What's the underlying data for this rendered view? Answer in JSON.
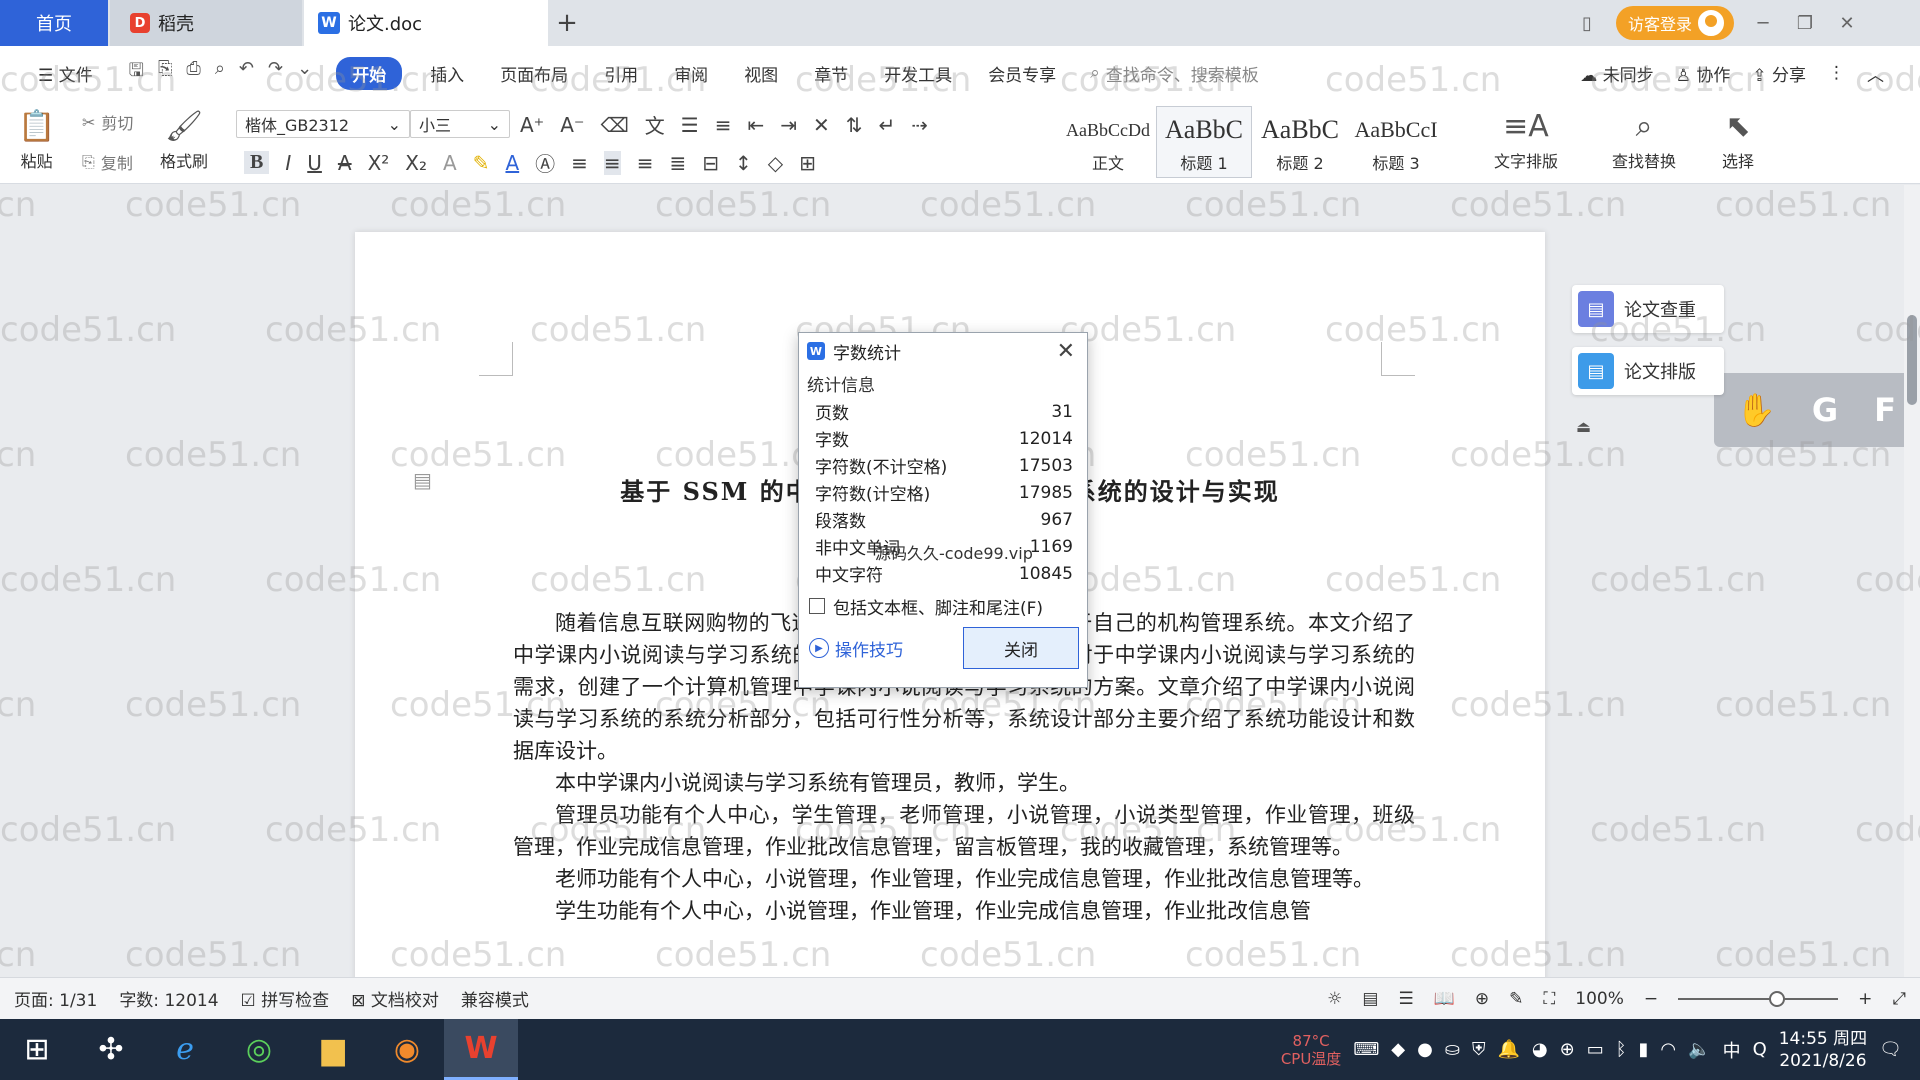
{
  "tabs": {
    "home": "首页",
    "daoke": "稻壳",
    "doc": "论文.doc",
    "add": "+"
  },
  "account": {
    "login": "访客登录"
  },
  "menu": {
    "file": "文件",
    "items": [
      "开始",
      "插入",
      "页面布局",
      "引用",
      "审阅",
      "视图",
      "章节",
      "开发工具",
      "会员专享"
    ],
    "search_placeholder": "查找命令、搜索模板",
    "sync": "未同步",
    "collab": "协作",
    "share": "分享"
  },
  "ribbon": {
    "paste": "粘贴",
    "cut": "剪切",
    "copy": "复制",
    "format_painter": "格式刷",
    "font_name": "楷体_GB2312",
    "font_size": "小三",
    "styles": [
      {
        "preview": "AaBbCcDd",
        "label": "正文"
      },
      {
        "preview": "AaBbC",
        "label": "标题 1"
      },
      {
        "preview": "AaBbC",
        "label": "标题 2"
      },
      {
        "preview": "AaBbCcI",
        "label": "标题 3"
      }
    ],
    "text_layout": "文字排版",
    "find_replace": "查找替换",
    "select": "选择"
  },
  "document": {
    "title": "基于 SSM 的中学课内小说阅读与学习系统的设计与实现",
    "paragraphs": [
      "随着信息互联网购物的飞速发展，一般企业都去创建属于自己的机构管理系统。本文介绍了中学课内小说阅读与学习系统的开发全过程。通过分析企业对于中学课内小说阅读与学习系统的需求，创建了一个计算机管理中学课内小说阅读与学习系统的方案。文章介绍了中学课内小说阅读与学习系统的系统分析部分，包括可行性分析等，系统设计部分主要介绍了系统功能设计和数据库设计。",
      "本中学课内小说阅读与学习系统有管理员，教师，学生。",
      "管理员功能有个人中心，学生管理，老师管理，小说管理，小说类型管理，作业管理，班级管理，作业完成信息管理，作业批改信息管理，留言板管理，我的收藏管理，系统管理等。",
      "老师功能有个人中心，小说管理，作业管理，作业完成信息管理，作业批改信息管理等。",
      "学生功能有个人中心，小说管理，作业管理，作业完成信息管理，作业批改信息管"
    ]
  },
  "side_panel": {
    "check": "论文查重",
    "layout": "论文排版"
  },
  "float_bar": {
    "letter1": "G",
    "letter2": "F"
  },
  "watermark": "code51.cn",
  "dialog": {
    "title": "字数统计",
    "section": "统计信息",
    "rows": [
      {
        "label": "页数",
        "value": "31"
      },
      {
        "label": "字数",
        "value": "12014"
      },
      {
        "label": "字符数(不计空格)",
        "value": "17503"
      },
      {
        "label": "字符数(计空格)",
        "value": "17985"
      },
      {
        "label": "段落数",
        "value": "967"
      },
      {
        "label": "非中文单词",
        "value": "1169"
      },
      {
        "label": "中文字符",
        "value": "10845"
      }
    ],
    "checkbox_label": "包括文本框、脚注和尾注(F)",
    "tips": "操作技巧",
    "close": "关闭",
    "overlay": "源码久久-code99.vip"
  },
  "status": {
    "page": "页面: 1/31",
    "words": "字数: 12014",
    "spell": "拼写检查",
    "proof": "文档校对",
    "compat": "兼容模式",
    "zoom": "100%",
    "zoom_level": 0.62
  },
  "taskbar": {
    "temp": "87°C",
    "cpu": "CPU温度",
    "ime": "中",
    "time": "14:55 周四",
    "date": "2021/8/26"
  },
  "colors": {
    "accent": "#2f63d8",
    "login": "#f3a126",
    "taskbar": "#1c2a3d"
  }
}
